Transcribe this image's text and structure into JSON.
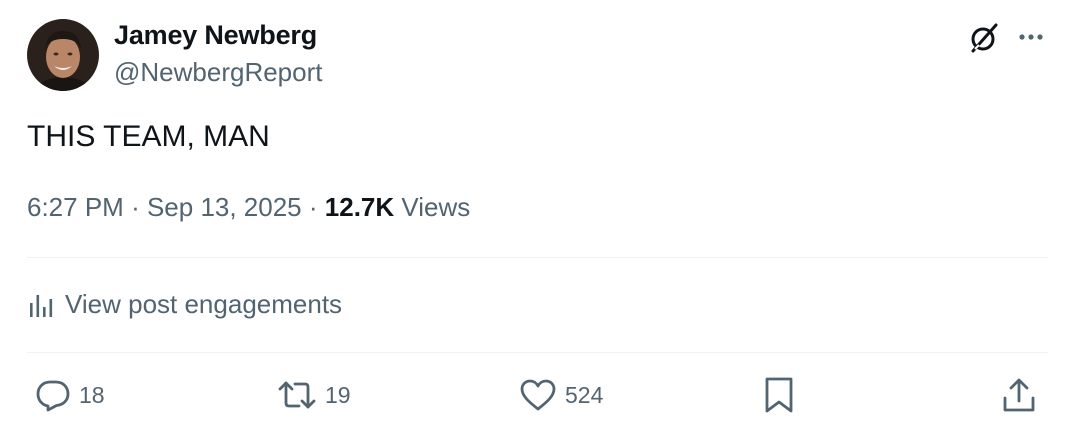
{
  "author": {
    "name": "Jamey Newberg",
    "handle": "@NewbergReport"
  },
  "post": {
    "text": "THIS TEAM, MAN",
    "time": "6:27 PM",
    "date": "Sep 13, 2025",
    "separator": "·",
    "views_count": "12.7K",
    "views_label": "Views"
  },
  "engagements": {
    "label": "View post engagements"
  },
  "actions": {
    "replies": "18",
    "reposts": "19",
    "likes": "524"
  },
  "icons": {
    "grok": "grok-icon",
    "more": "more-icon",
    "analytics": "analytics-icon",
    "reply": "reply-icon",
    "repost": "repost-icon",
    "like": "heart-icon",
    "bookmark": "bookmark-icon",
    "share": "share-icon"
  },
  "colors": {
    "text_primary": "#0f1419",
    "text_secondary": "#536471",
    "divider": "#eff3f4"
  }
}
